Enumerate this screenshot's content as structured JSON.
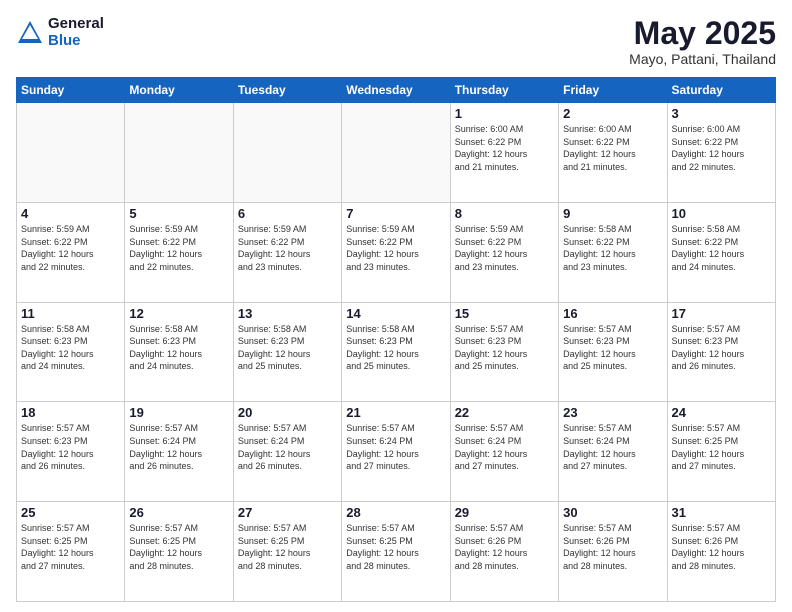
{
  "header": {
    "logo_general": "General",
    "logo_blue": "Blue",
    "title": "May 2025",
    "subtitle": "Mayo, Pattani, Thailand"
  },
  "calendar": {
    "days_of_week": [
      "Sunday",
      "Monday",
      "Tuesday",
      "Wednesday",
      "Thursday",
      "Friday",
      "Saturday"
    ],
    "weeks": [
      [
        {
          "day": "",
          "info": ""
        },
        {
          "day": "",
          "info": ""
        },
        {
          "day": "",
          "info": ""
        },
        {
          "day": "",
          "info": ""
        },
        {
          "day": "1",
          "info": "Sunrise: 6:00 AM\nSunset: 6:22 PM\nDaylight: 12 hours\nand 21 minutes."
        },
        {
          "day": "2",
          "info": "Sunrise: 6:00 AM\nSunset: 6:22 PM\nDaylight: 12 hours\nand 21 minutes."
        },
        {
          "day": "3",
          "info": "Sunrise: 6:00 AM\nSunset: 6:22 PM\nDaylight: 12 hours\nand 22 minutes."
        }
      ],
      [
        {
          "day": "4",
          "info": "Sunrise: 5:59 AM\nSunset: 6:22 PM\nDaylight: 12 hours\nand 22 minutes."
        },
        {
          "day": "5",
          "info": "Sunrise: 5:59 AM\nSunset: 6:22 PM\nDaylight: 12 hours\nand 22 minutes."
        },
        {
          "day": "6",
          "info": "Sunrise: 5:59 AM\nSunset: 6:22 PM\nDaylight: 12 hours\nand 23 minutes."
        },
        {
          "day": "7",
          "info": "Sunrise: 5:59 AM\nSunset: 6:22 PM\nDaylight: 12 hours\nand 23 minutes."
        },
        {
          "day": "8",
          "info": "Sunrise: 5:59 AM\nSunset: 6:22 PM\nDaylight: 12 hours\nand 23 minutes."
        },
        {
          "day": "9",
          "info": "Sunrise: 5:58 AM\nSunset: 6:22 PM\nDaylight: 12 hours\nand 23 minutes."
        },
        {
          "day": "10",
          "info": "Sunrise: 5:58 AM\nSunset: 6:22 PM\nDaylight: 12 hours\nand 24 minutes."
        }
      ],
      [
        {
          "day": "11",
          "info": "Sunrise: 5:58 AM\nSunset: 6:23 PM\nDaylight: 12 hours\nand 24 minutes."
        },
        {
          "day": "12",
          "info": "Sunrise: 5:58 AM\nSunset: 6:23 PM\nDaylight: 12 hours\nand 24 minutes."
        },
        {
          "day": "13",
          "info": "Sunrise: 5:58 AM\nSunset: 6:23 PM\nDaylight: 12 hours\nand 25 minutes."
        },
        {
          "day": "14",
          "info": "Sunrise: 5:58 AM\nSunset: 6:23 PM\nDaylight: 12 hours\nand 25 minutes."
        },
        {
          "day": "15",
          "info": "Sunrise: 5:57 AM\nSunset: 6:23 PM\nDaylight: 12 hours\nand 25 minutes."
        },
        {
          "day": "16",
          "info": "Sunrise: 5:57 AM\nSunset: 6:23 PM\nDaylight: 12 hours\nand 25 minutes."
        },
        {
          "day": "17",
          "info": "Sunrise: 5:57 AM\nSunset: 6:23 PM\nDaylight: 12 hours\nand 26 minutes."
        }
      ],
      [
        {
          "day": "18",
          "info": "Sunrise: 5:57 AM\nSunset: 6:23 PM\nDaylight: 12 hours\nand 26 minutes."
        },
        {
          "day": "19",
          "info": "Sunrise: 5:57 AM\nSunset: 6:24 PM\nDaylight: 12 hours\nand 26 minutes."
        },
        {
          "day": "20",
          "info": "Sunrise: 5:57 AM\nSunset: 6:24 PM\nDaylight: 12 hours\nand 26 minutes."
        },
        {
          "day": "21",
          "info": "Sunrise: 5:57 AM\nSunset: 6:24 PM\nDaylight: 12 hours\nand 27 minutes."
        },
        {
          "day": "22",
          "info": "Sunrise: 5:57 AM\nSunset: 6:24 PM\nDaylight: 12 hours\nand 27 minutes."
        },
        {
          "day": "23",
          "info": "Sunrise: 5:57 AM\nSunset: 6:24 PM\nDaylight: 12 hours\nand 27 minutes."
        },
        {
          "day": "24",
          "info": "Sunrise: 5:57 AM\nSunset: 6:25 PM\nDaylight: 12 hours\nand 27 minutes."
        }
      ],
      [
        {
          "day": "25",
          "info": "Sunrise: 5:57 AM\nSunset: 6:25 PM\nDaylight: 12 hours\nand 27 minutes."
        },
        {
          "day": "26",
          "info": "Sunrise: 5:57 AM\nSunset: 6:25 PM\nDaylight: 12 hours\nand 28 minutes."
        },
        {
          "day": "27",
          "info": "Sunrise: 5:57 AM\nSunset: 6:25 PM\nDaylight: 12 hours\nand 28 minutes."
        },
        {
          "day": "28",
          "info": "Sunrise: 5:57 AM\nSunset: 6:25 PM\nDaylight: 12 hours\nand 28 minutes."
        },
        {
          "day": "29",
          "info": "Sunrise: 5:57 AM\nSunset: 6:26 PM\nDaylight: 12 hours\nand 28 minutes."
        },
        {
          "day": "30",
          "info": "Sunrise: 5:57 AM\nSunset: 6:26 PM\nDaylight: 12 hours\nand 28 minutes."
        },
        {
          "day": "31",
          "info": "Sunrise: 5:57 AM\nSunset: 6:26 PM\nDaylight: 12 hours\nand 28 minutes."
        }
      ]
    ]
  }
}
